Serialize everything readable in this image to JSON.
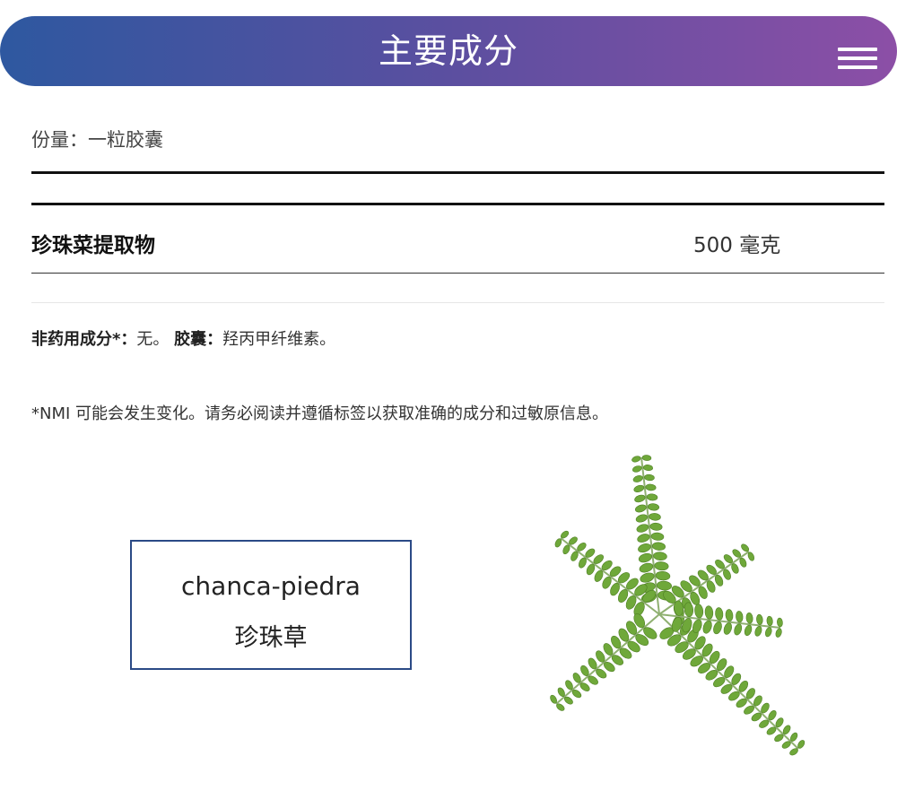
{
  "header": {
    "title": "主要成分",
    "menu_icon": "hamburger-menu-icon"
  },
  "facts": {
    "serving_label": "份量：",
    "serving_value": "一粒胶囊",
    "ingredient": {
      "name": "珍珠菜提取物",
      "amount": "500 毫克"
    },
    "other_label": "非药用成分*：",
    "other_value": "无。",
    "capsule_label": "胶囊：",
    "capsule_value": "羟丙甲纤维素。",
    "note": "*NMI 可能会发生变化。请务必阅读并遵循标签以获取准确的成分和过敏原信息。"
  },
  "herb": {
    "latin": "chanca-piedra",
    "chinese": "珍珠草"
  },
  "colors": {
    "header_gradient_start": "#2e58a0",
    "header_gradient_end": "#8c4fa6",
    "box_border": "#2b4a86",
    "leaf_green": "#6fa83a"
  }
}
